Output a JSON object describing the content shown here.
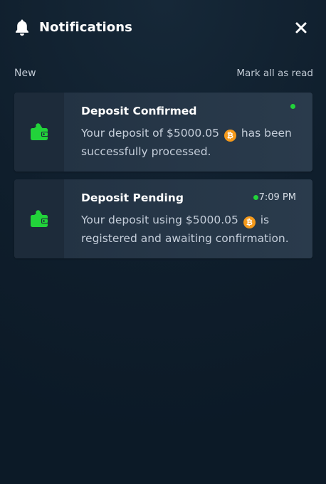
{
  "header": {
    "title": "Notifications",
    "bell_icon": "bell-icon",
    "close_icon": "close-icon"
  },
  "section": {
    "label": "New",
    "mark_all_label": "Mark all as read"
  },
  "notifications": [
    {
      "title": "Deposit Confirmed",
      "text_before": "Your deposit of $5000.05",
      "text_after": "has been successfully processed.",
      "time": "",
      "unread": true,
      "icon": "wallet-icon",
      "coin_symbol": "₿"
    },
    {
      "title": "Deposit Pending",
      "text_before": "Your deposit using $5000.05",
      "text_after": "is registered and awaiting confirmation.",
      "time": "7:09 PM",
      "unread": true,
      "icon": "wallet-icon",
      "coin_symbol": "₿"
    }
  ],
  "colors": {
    "accent_green": "#22d33a",
    "bitcoin_orange": "#f59a1b",
    "card_bg": "#243445",
    "page_bg": "#0f1e2c"
  }
}
